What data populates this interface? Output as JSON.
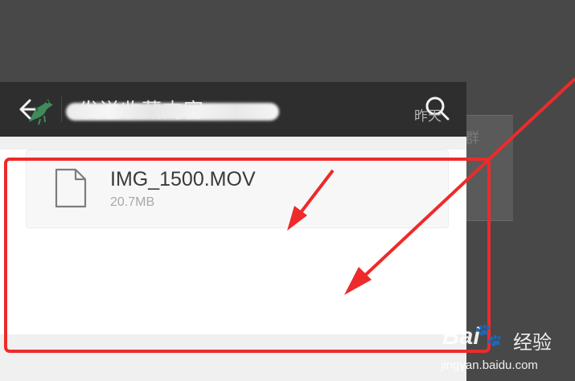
{
  "header": {
    "title": "发送收藏内容",
    "back_icon": "arrow-left-icon",
    "search_icon": "search-icon"
  },
  "background": {
    "partial_text": "群"
  },
  "favorite_item": {
    "date": "昨天",
    "file": {
      "name": "IMG_1500.MOV",
      "size": "20.7MB",
      "icon": "document-icon"
    }
  },
  "watermark": {
    "brand": "Bai",
    "brand_suffix": "经验",
    "url": "jingyan.baidu.com"
  },
  "colors": {
    "header_bg": "#2e2e2e",
    "annotation_red": "#ee2a2a"
  }
}
